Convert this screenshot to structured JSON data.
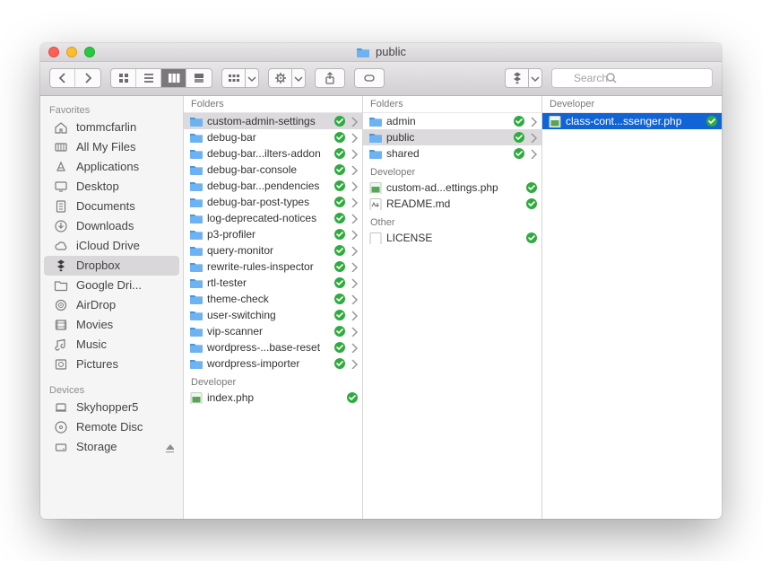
{
  "window": {
    "title": "public"
  },
  "toolbar": {
    "search_placeholder": "Search"
  },
  "sidebar": {
    "sections": [
      {
        "label": "Favorites",
        "items": [
          {
            "icon": "home",
            "label": "tommcfarlin"
          },
          {
            "icon": "allfiles",
            "label": "All My Files"
          },
          {
            "icon": "apps",
            "label": "Applications"
          },
          {
            "icon": "desktop",
            "label": "Desktop"
          },
          {
            "icon": "documents",
            "label": "Documents"
          },
          {
            "icon": "downloads",
            "label": "Downloads"
          },
          {
            "icon": "cloud",
            "label": "iCloud Drive"
          },
          {
            "icon": "dropbox",
            "label": "Dropbox",
            "selected": true
          },
          {
            "icon": "folder",
            "label": "Google Dri..."
          },
          {
            "icon": "airdrop",
            "label": "AirDrop"
          },
          {
            "icon": "movies",
            "label": "Movies"
          },
          {
            "icon": "music",
            "label": "Music"
          },
          {
            "icon": "pictures",
            "label": "Pictures"
          }
        ]
      },
      {
        "label": "Devices",
        "items": [
          {
            "icon": "laptop",
            "label": "Skyhopper5"
          },
          {
            "icon": "disc",
            "label": "Remote Disc"
          },
          {
            "icon": "drive",
            "label": "Storage",
            "eject": true
          }
        ]
      }
    ]
  },
  "columns": [
    {
      "groups": [
        {
          "label": "Folders",
          "items": [
            {
              "kind": "folder",
              "label": "custom-admin-settings",
              "synced": true,
              "chevron": true,
              "selected": "grey"
            },
            {
              "kind": "folder",
              "label": "debug-bar",
              "synced": true,
              "chevron": true
            },
            {
              "kind": "folder",
              "label": "debug-bar...ilters-addon",
              "synced": true,
              "chevron": true
            },
            {
              "kind": "folder",
              "label": "debug-bar-console",
              "synced": true,
              "chevron": true
            },
            {
              "kind": "folder",
              "label": "debug-bar...pendencies",
              "synced": true,
              "chevron": true
            },
            {
              "kind": "folder",
              "label": "debug-bar-post-types",
              "synced": true,
              "chevron": true
            },
            {
              "kind": "folder",
              "label": "log-deprecated-notices",
              "synced": true,
              "chevron": true
            },
            {
              "kind": "folder",
              "label": "p3-profiler",
              "synced": true,
              "chevron": true
            },
            {
              "kind": "folder",
              "label": "query-monitor",
              "synced": true,
              "chevron": true
            },
            {
              "kind": "folder",
              "label": "rewrite-rules-inspector",
              "synced": true,
              "chevron": true
            },
            {
              "kind": "folder",
              "label": "rtl-tester",
              "synced": true,
              "chevron": true
            },
            {
              "kind": "folder",
              "label": "theme-check",
              "synced": true,
              "chevron": true
            },
            {
              "kind": "folder",
              "label": "user-switching",
              "synced": true,
              "chevron": true
            },
            {
              "kind": "folder",
              "label": "vip-scanner",
              "synced": true,
              "chevron": true
            },
            {
              "kind": "folder",
              "label": "wordpress-...base-reset",
              "synced": true,
              "chevron": true
            },
            {
              "kind": "folder",
              "label": "wordpress-importer",
              "synced": true,
              "chevron": true
            }
          ]
        },
        {
          "label": "Developer",
          "items": [
            {
              "kind": "php",
              "label": "index.php",
              "synced": true
            }
          ]
        }
      ]
    },
    {
      "groups": [
        {
          "label": "Folders",
          "items": [
            {
              "kind": "folder",
              "label": "admin",
              "synced": true,
              "chevron": true
            },
            {
              "kind": "folder",
              "label": "public",
              "synced": true,
              "chevron": true,
              "selected": "grey"
            },
            {
              "kind": "folder",
              "label": "shared",
              "synced": true,
              "chevron": true
            }
          ]
        },
        {
          "label": "Developer",
          "items": [
            {
              "kind": "php",
              "label": "custom-ad...ettings.php",
              "synced": true
            },
            {
              "kind": "md",
              "label": "README.md",
              "synced": true
            }
          ]
        },
        {
          "label": "Other",
          "items": [
            {
              "kind": "blank",
              "label": "LICENSE",
              "synced": true
            }
          ]
        }
      ]
    },
    {
      "groups": [
        {
          "label": "Developer",
          "items": [
            {
              "kind": "php",
              "label": "class-cont...ssenger.php",
              "synced": true,
              "selected": "blue"
            }
          ]
        }
      ]
    }
  ]
}
